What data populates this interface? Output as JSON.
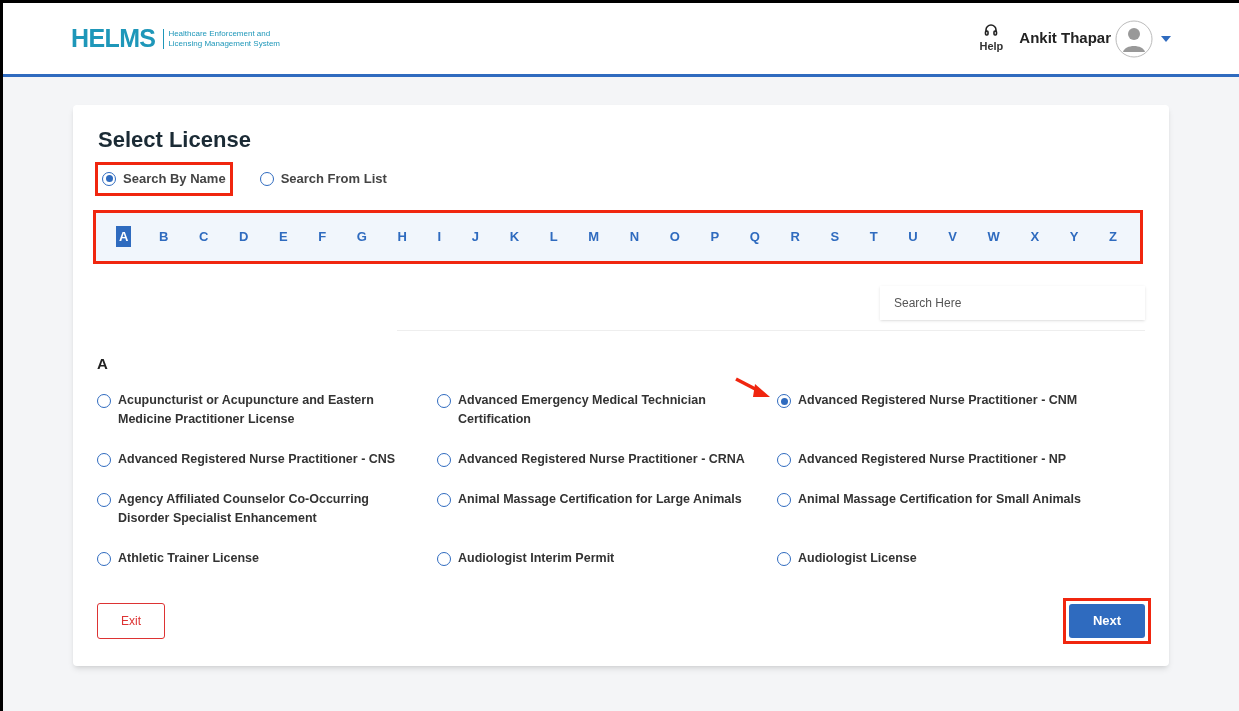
{
  "header": {
    "logo": "HELMS",
    "logo_subtitle": "Healthcare Enforcement and Licensing Management System",
    "help": "Help",
    "user_name": "Ankit Thapar"
  },
  "title": "Select License",
  "search_modes": [
    {
      "label": "Search By Name",
      "selected": true,
      "highlighted": true
    },
    {
      "label": "Search From List",
      "selected": false,
      "highlighted": false
    }
  ],
  "letter_bar": {
    "highlighted": true,
    "letters": [
      {
        "label": "A",
        "selected": true
      },
      {
        "label": "B",
        "selected": false
      },
      {
        "label": "C",
        "selected": false
      },
      {
        "label": "D",
        "selected": false
      },
      {
        "label": "E",
        "selected": false
      },
      {
        "label": "F",
        "selected": false
      },
      {
        "label": "G",
        "selected": false
      },
      {
        "label": "H",
        "selected": false
      },
      {
        "label": "I",
        "selected": false
      },
      {
        "label": "J",
        "selected": false
      },
      {
        "label": "K",
        "selected": false
      },
      {
        "label": "L",
        "selected": false
      },
      {
        "label": "M",
        "selected": false
      },
      {
        "label": "N",
        "selected": false
      },
      {
        "label": "O",
        "selected": false
      },
      {
        "label": "P",
        "selected": false
      },
      {
        "label": "Q",
        "selected": false
      },
      {
        "label": "R",
        "selected": false
      },
      {
        "label": "S",
        "selected": false
      },
      {
        "label": "T",
        "selected": false
      },
      {
        "label": "U",
        "selected": false
      },
      {
        "label": "V",
        "selected": false
      },
      {
        "label": "W",
        "selected": false
      },
      {
        "label": "X",
        "selected": false
      },
      {
        "label": "Y",
        "selected": false
      },
      {
        "label": "Z",
        "selected": false
      }
    ]
  },
  "search": {
    "placeholder": "Search Here"
  },
  "group_heading": "A",
  "licenses": [
    {
      "label": "Acupuncturist or Acupuncture and Eastern Medicine Practitioner License",
      "selected": false,
      "pointed": false
    },
    {
      "label": "Advanced Emergency Medical Technician Certification",
      "selected": false,
      "pointed": false
    },
    {
      "label": "Advanced Registered Nurse Practitioner - CNM",
      "selected": true,
      "pointed": true
    },
    {
      "label": "Advanced Registered Nurse Practitioner - CNS",
      "selected": false,
      "pointed": false
    },
    {
      "label": "Advanced Registered Nurse Practitioner - CRNA",
      "selected": false,
      "pointed": false
    },
    {
      "label": "Advanced Registered Nurse Practitioner - NP",
      "selected": false,
      "pointed": false
    },
    {
      "label": "Agency Affiliated Counselor Co-Occurring Disorder Specialist Enhancement",
      "selected": false,
      "pointed": false
    },
    {
      "label": "Animal Massage Certification for Large Animals",
      "selected": false,
      "pointed": false
    },
    {
      "label": "Animal Massage Certification for Small Animals",
      "selected": false,
      "pointed": false
    },
    {
      "label": "Athletic Trainer License",
      "selected": false,
      "pointed": false
    },
    {
      "label": "Audiologist Interim Permit",
      "selected": false,
      "pointed": false
    },
    {
      "label": "Audiologist License",
      "selected": false,
      "pointed": false
    }
  ],
  "buttons": {
    "exit": "Exit",
    "next": {
      "label": "Next",
      "highlighted": true
    }
  }
}
